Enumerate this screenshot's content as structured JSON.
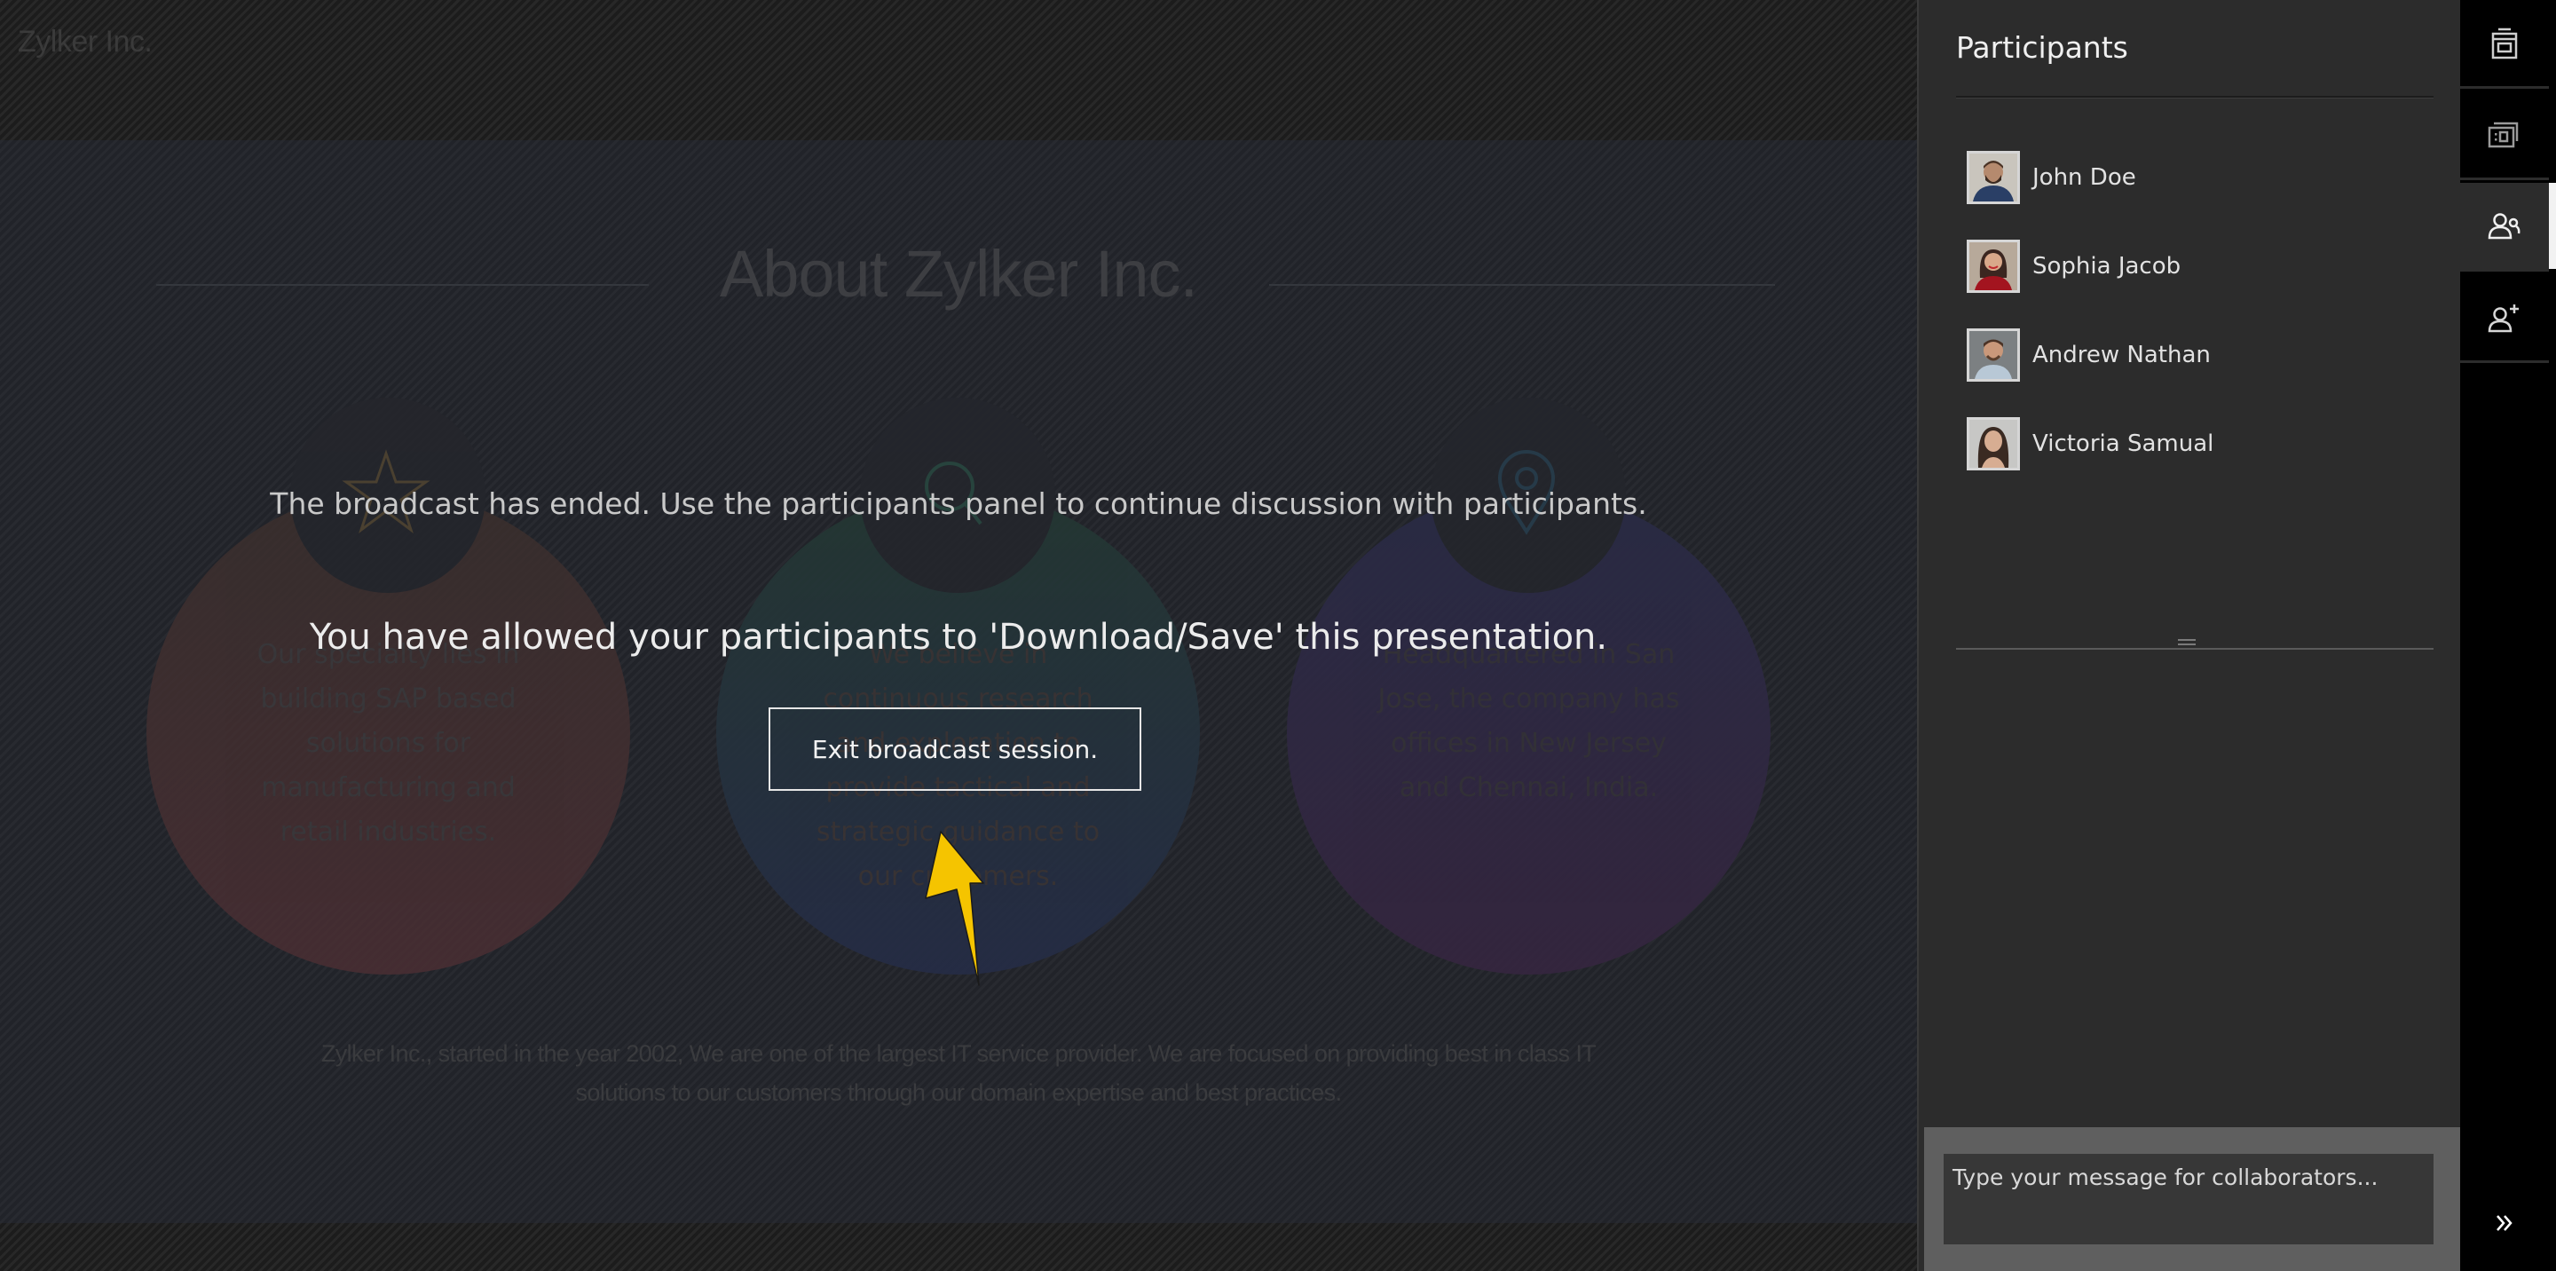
{
  "stage": {
    "brand": "Zylker Inc.",
    "slide": {
      "title": "About Zylker Inc.",
      "cards": [
        {
          "icon": "star-icon",
          "text": "Our specialty lies in building SAP based solutions for manufacturing and retail industries."
        },
        {
          "icon": "search-icon",
          "text": "We believe in continuous research and exploration to provide tactical and strategic guidance to our customers."
        },
        {
          "icon": "location-pin-icon",
          "text": "Headquartered in San Jose, the company has offices in New Jersey and Chennai, India."
        }
      ],
      "footer": "Zylker Inc., started in the year 2002, We are one of the largest IT service provider. We are focused on providing best in class IT solutions to our customers through our domain expertise and best practices."
    },
    "overlay": {
      "ended_message": "The broadcast has ended. Use the participants panel to continue discussion with participants.",
      "download_message": "You have allowed your participants to 'Download/Save' this presentation.",
      "exit_button_label": "Exit broadcast session.",
      "pointer_icon": "pointer-arrow-icon",
      "pointer_color": "#F5C400"
    }
  },
  "panel": {
    "title": "Participants",
    "participants": [
      {
        "name": "John Doe"
      },
      {
        "name": "Sophia Jacob"
      },
      {
        "name": "Andrew Nathan"
      },
      {
        "name": "Victoria Samual"
      }
    ],
    "message_placeholder": "Type your message for collaborators..."
  },
  "rail": {
    "items": [
      {
        "icon": "slide-notes-icon",
        "active": false
      },
      {
        "icon": "slides-panel-icon",
        "active": false
      },
      {
        "icon": "participants-icon",
        "active": true
      },
      {
        "icon": "add-participant-icon",
        "active": false
      }
    ],
    "collapse_icon": "double-chevron-right-icon"
  },
  "colors": {
    "accent_pointer": "#F5C400",
    "panel_bg": "#2C2C2C",
    "rail_bg": "#000000"
  }
}
